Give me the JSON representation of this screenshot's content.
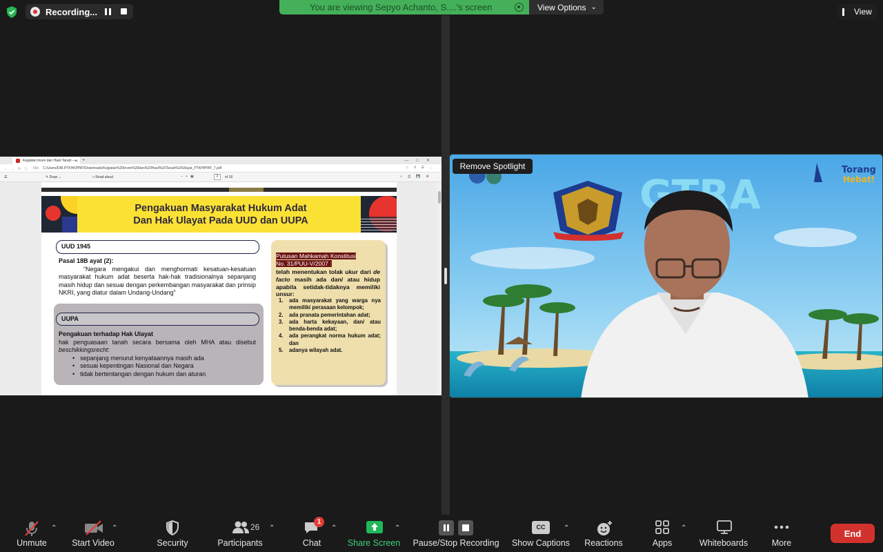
{
  "topbar": {
    "recording_label": "Recording...",
    "viewing_text": "You are viewing Sepyo Achanto, S....'s screen",
    "view_options": "View Options",
    "view_label": "View"
  },
  "browser": {
    "tab_title": "Kegiatan Inven dan Hasil Tanah —",
    "address_prefix": "File",
    "url": "C:/Users/DIR.PTKHKPPAT/Downloads/Kegiatan%20Inven%20dan%20Hasil%20Tanah%20Ulayat_PTKHPPAT_7.pdf",
    "draw_label": "Draw",
    "read_aloud": "Read aloud",
    "page_num": "2",
    "page_of": "of 18"
  },
  "slide": {
    "title_line1": "Pengakuan Masyarakat Hukum Adat",
    "title_line2": "Dan Hak Ulayat Pada UUD dan UUPA",
    "uud_label": "UUD 1945",
    "uud_heading": "Pasal 18B ayat (2):",
    "uud_text": "“Negara mengakui dan menghormati kesatuan-kesatuan masyarakat hukum adat beserta hak-hak tradisionalnya sepanjang masih hidup dan sesuai dengan perkembangan masyarakat dan prinsip NKRI, yang diatur dalam Undang-Undang”",
    "uupa_label": "UUPA",
    "uupa_heading": "Pengakuan terhadap Hak Ulayat",
    "uupa_text_plain": "hak penguasaan tanah secara bersama oleh MHA atau disebut ",
    "uupa_text_italic": "beschikkingsrecht",
    "uupa_text_end": ":",
    "uupa_items": [
      "sepanjang menurut kenyataannya masih ada",
      "sesuai kepentingan Nasional dan Negara",
      "tidak bertentangan dengan hukum dan aturan"
    ],
    "mk_title_line1": "Putusan Mahkamah Konstitusi",
    "mk_title_line2": "No. 31/PUU-V/2007 :",
    "mk_body_a": "telah menentukan tolak ukur dari ",
    "mk_body_italic": "de facto",
    "mk_body_b": " masih ada dan/ atau hidup apabila setidak-tidaknya memiliki unsur:",
    "mk_items": [
      {
        "n": "1.",
        "t": "ada masyarakat yang warga nya memiliki perasaan kelompok;"
      },
      {
        "n": "2.",
        "t": "ada pranata pemerintahan adat;"
      },
      {
        "n": "3.",
        "t": "ada harta kekayaan, dan/ atau benda-benda adat;"
      },
      {
        "n": "4.",
        "t": "ada perangkat norma hukum adat; dan"
      },
      {
        "n": "5.",
        "t": "adanya wilayah adat."
      }
    ]
  },
  "video": {
    "remove_spotlight": "Remove Spotlight",
    "banner_text": "GTRA",
    "banner_slogan_1": "Torang",
    "banner_slogan_2": "Hebat!"
  },
  "toolbar": {
    "unmute": "Unmute",
    "start_video": "Start Video",
    "security": "Security",
    "participants": "Participants",
    "participants_count": "26",
    "chat": "Chat",
    "chat_badge": "1",
    "share_screen": "Share Screen",
    "pause_stop_recording": "Pause/Stop Recording",
    "show_captions": "Show Captions",
    "cc_glyph": "CC",
    "reactions": "Reactions",
    "apps": "Apps",
    "whiteboards": "Whiteboards",
    "more": "More",
    "end": "End"
  },
  "colors": {
    "green_banner": "#44b05a",
    "end_red": "#d2322d",
    "share_green": "#1fb85a",
    "slide_yellow": "#fce135"
  }
}
